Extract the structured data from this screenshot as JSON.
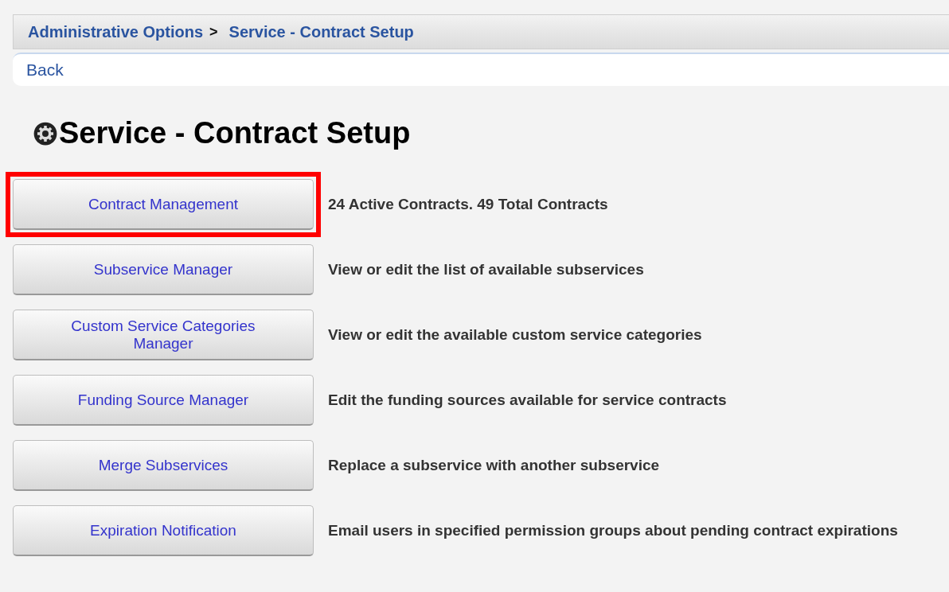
{
  "breadcrumb": {
    "items": [
      {
        "label": "Administrative Options"
      },
      {
        "label": "Service - Contract Setup"
      }
    ],
    "separator": ">"
  },
  "back_link": "Back",
  "title": "Service - Contract Setup",
  "options": [
    {
      "button": "Contract Management",
      "description": "24 Active Contracts. 49 Total Contracts",
      "highlighted": true
    },
    {
      "button": "Subservice Manager",
      "description": "View or edit the list of available subservices",
      "highlighted": false
    },
    {
      "button": "Custom Service Categories Manager",
      "description": "View or edit the available custom service categories",
      "highlighted": false
    },
    {
      "button": "Funding Source Manager",
      "description": "Edit the funding sources available for service contracts",
      "highlighted": false
    },
    {
      "button": "Merge Subservices",
      "description": "Replace a subservice with another subservice",
      "highlighted": false
    },
    {
      "button": "Expiration Notification",
      "description": "Email users in specified permission groups about pending contract expirations",
      "highlighted": false
    }
  ]
}
